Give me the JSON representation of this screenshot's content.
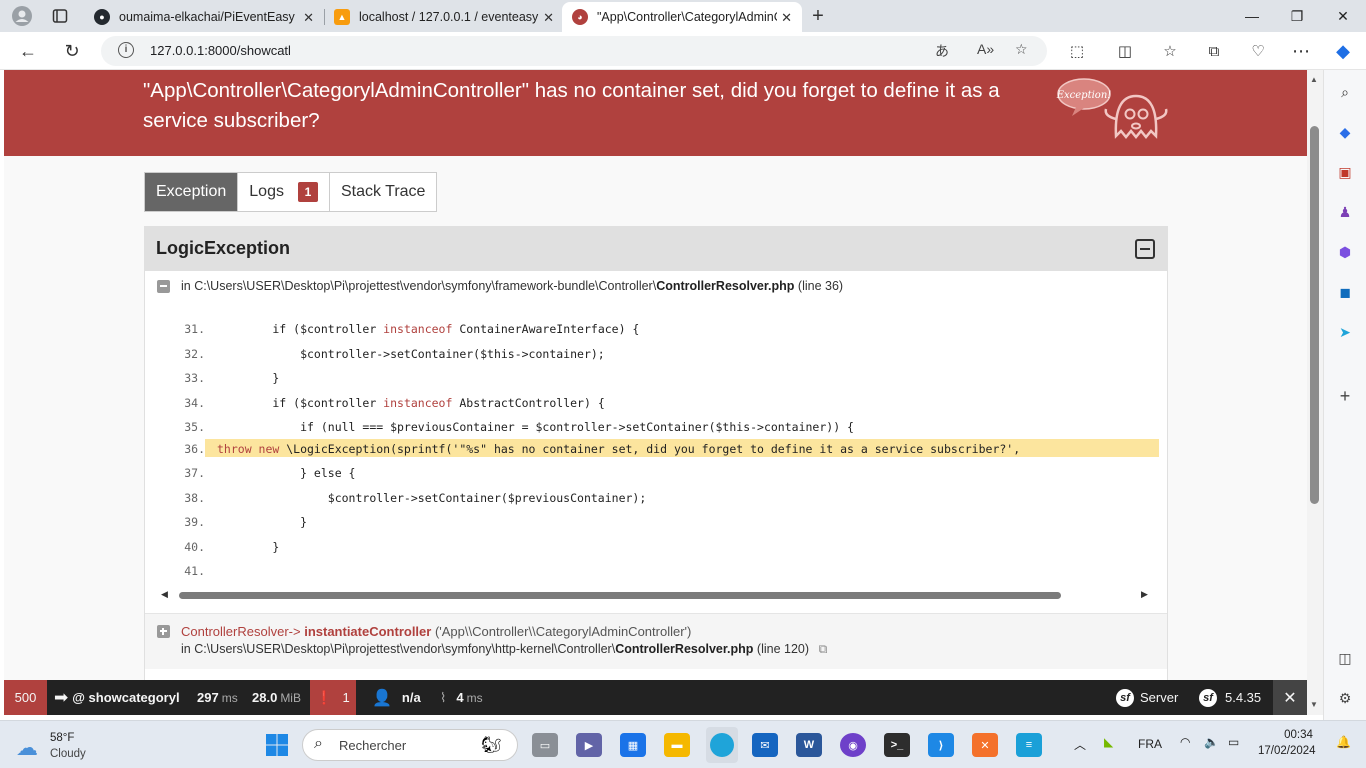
{
  "browser": {
    "tabs": [
      {
        "title": "oumaima-elkachai/PiEventEasy",
        "icon": "github-icon"
      },
      {
        "title": "localhost / 127.0.0.1 / eventeasy",
        "icon": "phpmyadmin-icon"
      },
      {
        "title": "\"App\\Controller\\CategorylAdminCont",
        "icon": "symfony-ghost-icon"
      }
    ],
    "url": "127.0.0.1:8000/showcatl"
  },
  "error": {
    "title": "\"App\\Controller\\CategorylAdminController\" has no container set, did you forget to define it as a service subscriber?",
    "mascot_label": "Exception!"
  },
  "page_tabs": {
    "exception": "Exception",
    "logs": "Logs",
    "logs_count": "1",
    "stack_trace": "Stack Trace"
  },
  "exception": {
    "class": "LogicException",
    "trace1": {
      "prefix": "in C:\\Users\\USER\\Desktop\\Pi\\projettest\\vendor\\symfony\\framework-bundle\\Controller\\",
      "file": "ControllerResolver.php",
      "line": "(line 36)"
    },
    "code": [
      {
        "n": "31.",
        "parts": [
          "        if ($controller ",
          "instanceof",
          " ContainerAwareInterface) {"
        ]
      },
      {
        "n": "32.",
        "parts": [
          "            $controller->setContainer($this->container);"
        ]
      },
      {
        "n": "33.",
        "parts": [
          "        }"
        ]
      },
      {
        "n": "34.",
        "parts": [
          "        if ($controller ",
          "instanceof",
          " AbstractController) {"
        ]
      },
      {
        "n": "35.",
        "parts": [
          "            if (null === $previousContainer = $controller->setContainer($this->container)) {"
        ]
      },
      {
        "n": "36.",
        "parts": [
          "throw new \\LogicException(sprintf('\"%s\" has no container set, did you forget to define it as a service subscriber?',"
        ]
      },
      {
        "n": "37.",
        "parts": [
          "            } else {"
        ]
      },
      {
        "n": "38.",
        "parts": [
          "                $controller->setContainer($previousContainer);"
        ]
      },
      {
        "n": "39.",
        "parts": [
          "            }"
        ]
      },
      {
        "n": "40.",
        "parts": [
          "        }"
        ]
      },
      {
        "n": "41.",
        "parts": [
          ""
        ]
      }
    ],
    "trace2": {
      "class": "ControllerResolver",
      "arrow": "->",
      "method": "instantiateController",
      "args": "('App\\\\Controller\\\\CategorylAdminController')",
      "prefix": "in C:\\Users\\USER\\Desktop\\Pi\\projettest\\vendor\\symfony\\http-kernel\\Controller\\",
      "file": "ControllerResolver.php",
      "line": "(line 120)"
    }
  },
  "profiler": {
    "status": "500",
    "route": "@ showcategoryl",
    "time": "297",
    "time_unit": "ms",
    "memory": "28.0",
    "memory_unit": "MiB",
    "errors": "1",
    "user": "n/a",
    "db_time": "4",
    "db_unit": "ms",
    "server": "Server",
    "version": "5.4.35"
  },
  "taskbar": {
    "weather_temp": "58°F",
    "weather_desc": "Cloudy",
    "search_placeholder": "Rechercher",
    "lang": "FRA",
    "time": "00:34",
    "date": "17/02/2024"
  }
}
